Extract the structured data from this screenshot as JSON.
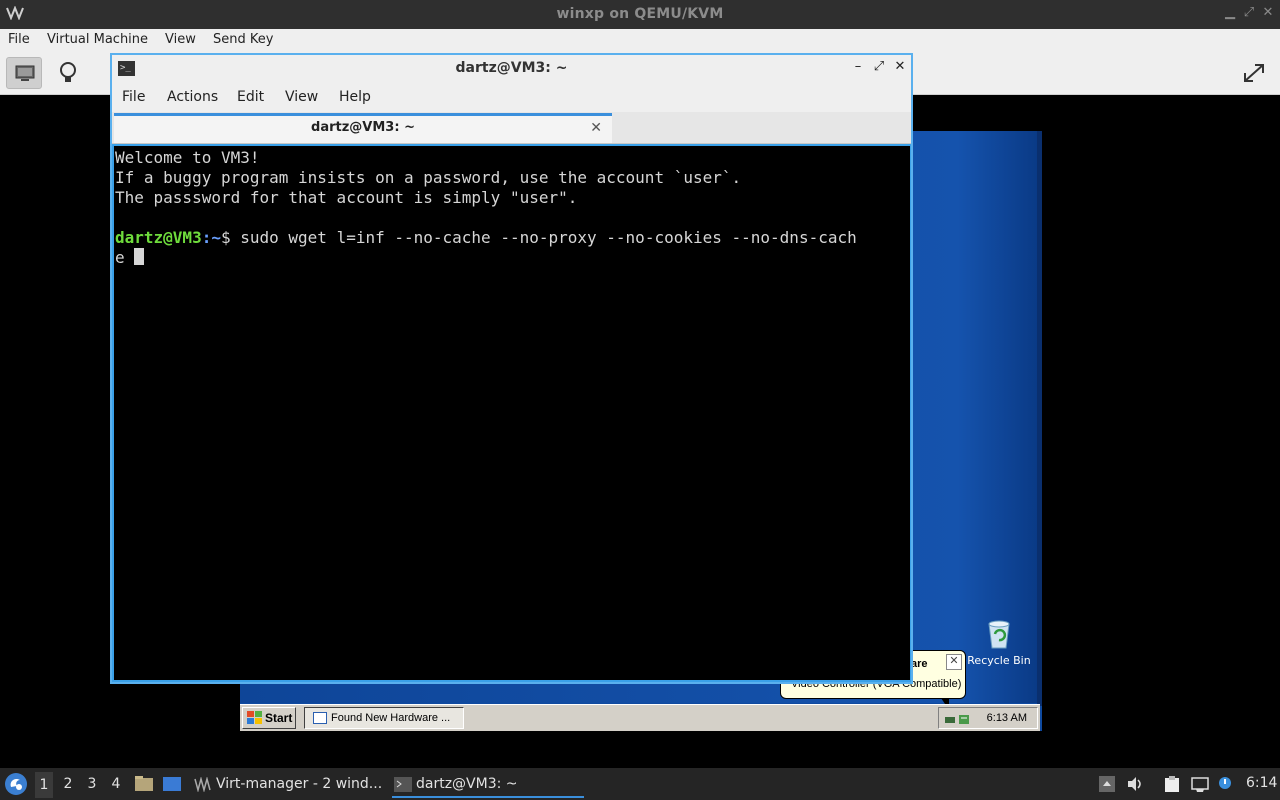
{
  "outer_window": {
    "title": "winxp on QEMU/KVM",
    "menu": [
      "File",
      "Virtual Machine",
      "View",
      "Send Key"
    ]
  },
  "terminal": {
    "title": "dartz@VM3: ~",
    "menu": [
      "File",
      "Actions",
      "Edit",
      "View",
      "Help"
    ],
    "tab_label": "dartz@VM3: ~",
    "lines": [
      "Welcome to VM3!",
      "If a buggy program insists on a password, use the account `user`.",
      "The passsword for that account is simply \"user\"."
    ],
    "prompt_user": "dartz@VM3",
    "prompt_path": ":~",
    "prompt_symbol": "$ ",
    "command_line1": "sudo wget l=inf --no-cache --no-proxy --no-cookies --no-dns-cach",
    "command_line2": "e "
  },
  "guest": {
    "recycle_bin_label": "Recycle Bin",
    "balloon_title": "are",
    "balloon_text": "Video Controller (VGA Compatible)",
    "start_label": "Start",
    "taskbar_item": "Found New Hardware ...",
    "clock": "6:13 AM"
  },
  "host_panel": {
    "workspaces": [
      "1",
      "2",
      "3",
      "4"
    ],
    "current_workspace": "1",
    "tasks": [
      {
        "label": "Virt-manager - 2 wind..."
      },
      {
        "label": "dartz@VM3: ~"
      }
    ],
    "clock": "6:14"
  },
  "colors": {
    "accent": "#3a8fdc",
    "prompt_user": "#6fdc3c",
    "prompt_path": "#6aa0ff",
    "xp_blue": "#1553ad"
  }
}
